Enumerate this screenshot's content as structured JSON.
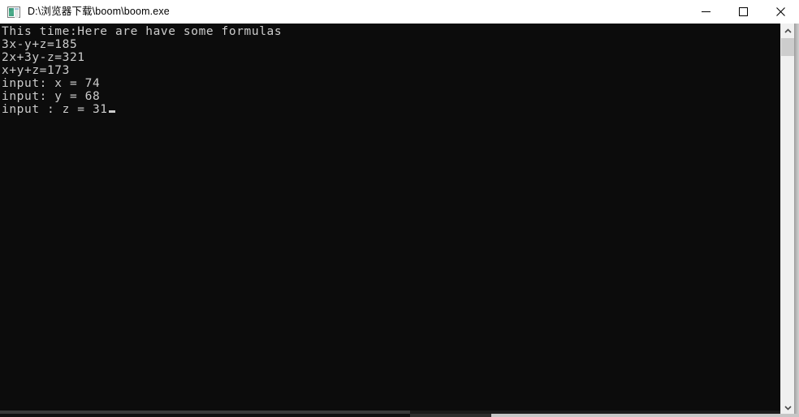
{
  "window": {
    "title": "D:\\浏览器下载\\boom\\boom.exe",
    "icon_name": "console-app-icon",
    "background_color": "#0c0c0c",
    "text_color": "#cccccc",
    "title_bar_color": "#ffffff"
  },
  "controls": {
    "minimize_label": "Minimize",
    "maximize_label": "Maximize",
    "close_label": "Close"
  },
  "console": {
    "lines": [
      "This time:Here are have some formulas",
      "3x-y+z=185",
      "2x+3y-z=321",
      "x+y+z=173",
      "input: x = 74",
      "input: y = 68",
      "input : z = 31"
    ],
    "text": "This time:Here are have some formulas\n3x-y+z=185\n2x+3y-z=321\nx+y+z=173\ninput: x = 74\ninput: y = 68\ninput : z = 31",
    "cursor_after": "31",
    "cursor_style": "underscore-block",
    "equations": [
      {
        "expression": "3x-y+z",
        "value": "185"
      },
      {
        "expression": "2x+3y-z",
        "value": "321"
      },
      {
        "expression": "x+y+z",
        "value": "173"
      }
    ],
    "inputs": [
      {
        "prompt": "input:",
        "variable": "x",
        "value": "74"
      },
      {
        "prompt": "input:",
        "variable": "y",
        "value": "68"
      },
      {
        "prompt": "input :",
        "variable": "z",
        "value": "31"
      }
    ]
  },
  "scrollbars": {
    "vertical": {
      "up_arrow": "▲",
      "down_arrow": "▼",
      "thumb_position_percent": 4,
      "thumb_size_percent": 5
    },
    "horizontal": {
      "thumb_position_percent": 0,
      "thumb_size_percent": 52
    }
  }
}
